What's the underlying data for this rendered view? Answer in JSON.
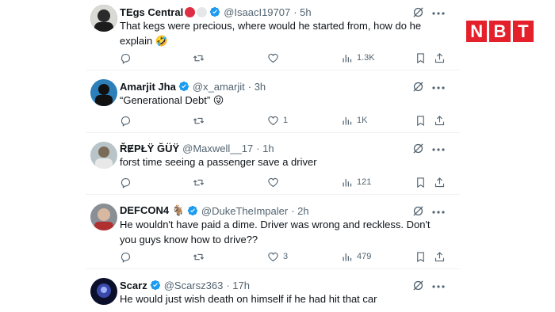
{
  "brand": {
    "letters": [
      "N",
      "B",
      "T"
    ],
    "color": "#e4202a"
  },
  "tweets": [
    {
      "name": "TEgs Central",
      "handle": "@IsaacI19707",
      "time": "· 5h",
      "text": "That kegs were precious, where would he started from, how do he explain 🤣",
      "replies": "",
      "retweets": "",
      "likes": "",
      "views": "1.3K"
    },
    {
      "name": "Amarjit Jha",
      "handle": "@x_amarjit",
      "time": "· 3h",
      "text": "“Generational Debt” 😜",
      "replies": "",
      "retweets": "",
      "likes": "1",
      "views": "1K"
    },
    {
      "name": "ŘɆPŁŸ ĞÜŸ",
      "handle": "@Maxwell__17",
      "time": "· 1h",
      "text": "forst time seeing a passenger save a driver",
      "replies": "",
      "retweets": "",
      "likes": "",
      "views": "121"
    },
    {
      "name": "DEFCON4 🐐",
      "handle": "@DukeTheImpaler",
      "time": "· 2h",
      "text": "He wouldn't have paid a dime. Driver was wrong and reckless. Don't you guys know how to drive??",
      "replies": "",
      "retweets": "",
      "likes": "3",
      "views": "479"
    },
    {
      "name": "Scarz",
      "handle": "@Scarsz363",
      "time": "· 17h",
      "text": "He would just wish death on himself if he had hit that car",
      "replies": "",
      "retweets": "",
      "likes": "",
      "views": ""
    }
  ],
  "colors": {
    "text": "#0f1419",
    "meta": "#536471",
    "verified": "#1d9bf0",
    "divider": "#eff3f4"
  }
}
